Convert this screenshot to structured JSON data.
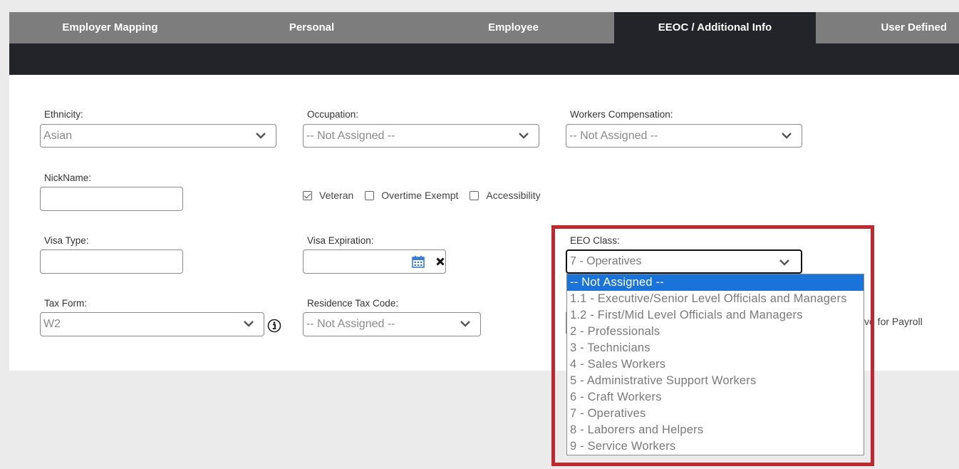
{
  "tabs": [
    {
      "label": "Employer Mapping",
      "active": false
    },
    {
      "label": "Personal",
      "active": false
    },
    {
      "label": "Employee",
      "active": false
    },
    {
      "label": "EEOC / Additional Info",
      "active": true
    },
    {
      "label": "User Defined",
      "active": false
    }
  ],
  "form": {
    "ethnicity": {
      "label": "Ethnicity:",
      "value": "Asian"
    },
    "occupation": {
      "label": "Occupation:",
      "value": "-- Not Assigned --"
    },
    "workers_comp": {
      "label": "Workers Compensation:",
      "value": "-- Not Assigned --"
    },
    "nickname": {
      "label": "NickName:",
      "value": ""
    },
    "checkboxes": [
      {
        "label": "Veteran",
        "checked": true
      },
      {
        "label": "Overtime Exempt",
        "checked": false
      },
      {
        "label": "Accessibility",
        "checked": false
      }
    ],
    "visa_type": {
      "label": "Visa Type:",
      "value": ""
    },
    "visa_expiration": {
      "label": "Visa Expiration:",
      "value": ""
    },
    "eeo_class": {
      "label": "EEO Class:",
      "value": "7 - Operatives",
      "options": [
        "-- Not Assigned --",
        "1.1 - Executive/Senior Level Officials and Managers",
        "1.2 - First/Mid Level Officials and Managers",
        "2 - Professionals",
        "3 - Technicians",
        "4 - Sales Workers",
        "5 - Administrative Support Workers",
        "6 - Craft Workers",
        "7 - Operatives",
        "8 - Laborers and Helpers",
        "9 - Service Workers"
      ],
      "highlighted_option": "-- Not Assigned --"
    },
    "tax_form": {
      "label": "Tax Form:",
      "value": "W2"
    },
    "residence_tax_code": {
      "label": "Residence Tax Code:",
      "value": "-- Not Assigned --"
    },
    "partial_label": "ve for Payroll"
  },
  "icons": {
    "chevron": "chevron-down-icon",
    "calendar": "calendar-icon",
    "clear": "close-icon",
    "info": "info-icon"
  },
  "colors": {
    "active_tab": "#222429",
    "tab_bar": "#7d7d7d",
    "highlight_border": "#c0282d",
    "selected_option": "#1a73d9"
  }
}
